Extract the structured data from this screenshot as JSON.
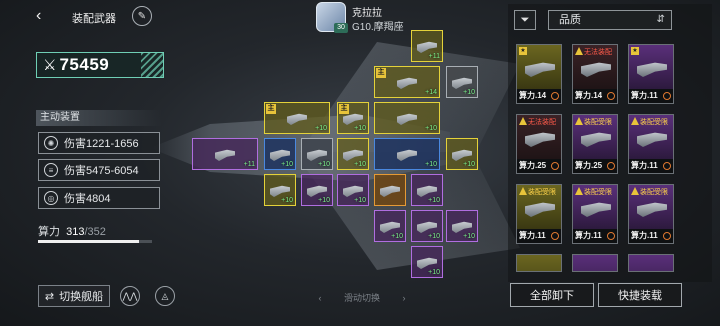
{
  "header": {
    "back_icon": "back-arrow-icon",
    "title": "装配武器",
    "edit_icon": "pen-icon"
  },
  "commander": {
    "name": "克拉拉",
    "level": "30",
    "subtitle": "G10.摩羯座"
  },
  "power": {
    "icon": "⚔",
    "value": "75459"
  },
  "active": {
    "label": "主动装置",
    "skills": [
      {
        "icon": "gear-icon",
        "text": "伤害1221-1656"
      },
      {
        "icon": "streak-icon",
        "text": "伤害5475-6054"
      },
      {
        "icon": "target-icon",
        "text": "伤害4804"
      }
    ]
  },
  "compute": {
    "label": "算力",
    "current": "313",
    "max": "/352",
    "fraction": 0.889
  },
  "footer": {
    "switch_ship": "切换舰船",
    "swipe_hint": "滑动切换",
    "unequip_all": "全部卸下",
    "quick_equip": "快捷装载"
  },
  "grid": {
    "slots": [
      {
        "id": "s1",
        "rarity": "y",
        "level": "+11",
        "tag": ""
      },
      {
        "id": "s2",
        "rarity": "y",
        "level": "+14",
        "tag": "主"
      },
      {
        "id": "s3",
        "rarity": "w",
        "level": "+10",
        "tag": ""
      },
      {
        "id": "s4",
        "rarity": "y",
        "level": "+10",
        "tag": "主"
      },
      {
        "id": "s5",
        "rarity": "b",
        "level": "",
        "tag": ""
      },
      {
        "id": "s6",
        "rarity": "y",
        "level": "+10",
        "tag": "主"
      },
      {
        "id": "s7",
        "rarity": "y",
        "level": "+10",
        "tag": ""
      },
      {
        "id": "s8",
        "rarity": "p",
        "level": "+11",
        "tag": ""
      },
      {
        "id": "s9",
        "rarity": "b",
        "level": "+10",
        "tag": ""
      },
      {
        "id": "s10",
        "rarity": "w",
        "level": "+10",
        "tag": ""
      },
      {
        "id": "s11",
        "rarity": "y",
        "level": "+10",
        "tag": ""
      },
      {
        "id": "s12",
        "rarity": "b",
        "level": "+10",
        "tag": ""
      },
      {
        "id": "s13",
        "rarity": "y",
        "level": "+10",
        "tag": ""
      },
      {
        "id": "s14",
        "rarity": "y",
        "level": "+10",
        "tag": ""
      },
      {
        "id": "s15",
        "rarity": "p",
        "level": "+10",
        "tag": ""
      },
      {
        "id": "s16",
        "rarity": "p",
        "level": "+10",
        "tag": ""
      },
      {
        "id": "s17",
        "rarity": "o",
        "level": "",
        "tag": ""
      },
      {
        "id": "s18",
        "rarity": "p",
        "level": "+10",
        "tag": ""
      },
      {
        "id": "s19",
        "rarity": "p",
        "level": "+10",
        "tag": ""
      },
      {
        "id": "s20",
        "rarity": "p",
        "level": "+10",
        "tag": ""
      },
      {
        "id": "s21",
        "rarity": "p",
        "level": "+10",
        "tag": ""
      },
      {
        "id": "s22",
        "rarity": "p",
        "level": "+10",
        "tag": ""
      }
    ]
  },
  "inventory": {
    "filter_icon": "filter-icon",
    "quality_label": "品质",
    "sort_icon": "sort-icon",
    "cards": [
      {
        "quality": "y",
        "status": "",
        "status_color": "",
        "power": "算力.14",
        "star": true
      },
      {
        "quality": "r",
        "status": "无法装配",
        "status_color": "red",
        "power": "算力.14",
        "star": false
      },
      {
        "quality": "p",
        "status": "",
        "status_color": "",
        "power": "算力.11",
        "star": true
      },
      {
        "quality": "r",
        "status": "无法装配",
        "status_color": "red",
        "power": "算力.25",
        "star": false
      },
      {
        "quality": "p",
        "status": "装配受限",
        "status_color": "yellow",
        "power": "算力.25",
        "star": false
      },
      {
        "quality": "p",
        "status": "装配受限",
        "status_color": "yellow",
        "power": "算力.11",
        "star": false
      },
      {
        "quality": "y",
        "status": "装配受限",
        "status_color": "yellow",
        "power": "算力.11",
        "star": false
      },
      {
        "quality": "p",
        "status": "装配受限",
        "status_color": "yellow",
        "power": "算力.11",
        "star": false
      },
      {
        "quality": "p",
        "status": "装配受限",
        "status_color": "yellow",
        "power": "算力.11",
        "star": false
      },
      {
        "quality": "y",
        "status": "",
        "status_color": "",
        "power": "",
        "star": false
      },
      {
        "quality": "p",
        "status": "",
        "status_color": "",
        "power": "",
        "star": false
      },
      {
        "quality": "p",
        "status": "",
        "status_color": "",
        "power": "",
        "star": false
      }
    ]
  }
}
